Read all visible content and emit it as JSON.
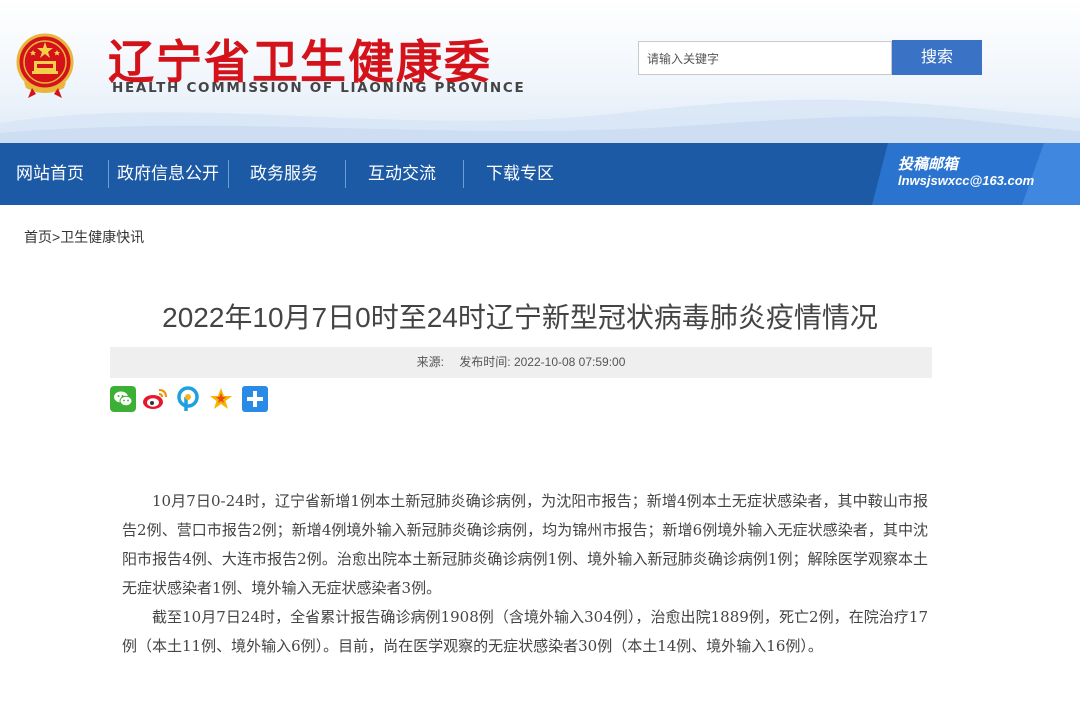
{
  "header": {
    "title": "辽宁省卫生健康委",
    "subtitle": "HEALTH COMMISSION OF LIAONING PROVINCE",
    "search_placeholder": "请输入关键字",
    "search_button": "搜索"
  },
  "nav": {
    "items": [
      {
        "label": "网站首页"
      },
      {
        "label": "政府信息公开"
      },
      {
        "label": "政务服务"
      },
      {
        "label": "互动交流"
      },
      {
        "label": "下载专区"
      }
    ],
    "mailbox": {
      "title": "投稿邮箱",
      "address": "lnwsjswxcc@163.com"
    }
  },
  "breadcrumb": {
    "home": "首页",
    "separator": ">",
    "current": "卫生健康快讯"
  },
  "article": {
    "title": "2022年10月7日0时至24时辽宁新型冠状病毒肺炎疫情情况",
    "source_label": "来源:",
    "publish_label": "发布时间: 2022-10-08 07:59:00",
    "share_icons": [
      "wechat-icon",
      "weibo-icon",
      "qzone-icon",
      "star-icon",
      "plus-icon"
    ],
    "paragraphs": [
      "10月7日0-24时，辽宁省新增1例本土新冠肺炎确诊病例，为沈阳市报告；新增4例本土无症状感染者，其中鞍山市报告2例、营口市报告2例；新增4例境外输入新冠肺炎确诊病例，均为锦州市报告；新增6例境外输入无症状感染者，其中沈阳市报告4例、大连市报告2例。治愈出院本土新冠肺炎确诊病例1例、境外输入新冠肺炎确诊病例1例；解除医学观察本土无症状感染者1例、境外输入无症状感染者3例。",
      "截至10月7日24时，全省累计报告确诊病例1908例（含境外输入304例），治愈出院1889例，死亡2例，在院治疗17例（本土11例、境外输入6例）。目前，尚在医学观察的无症状感染者30例（本土14例、境外输入16例）。"
    ]
  },
  "colors": {
    "brand_red": "#d4121a",
    "nav_blue": "#1c5aa6",
    "button_blue": "#3a73c6"
  }
}
